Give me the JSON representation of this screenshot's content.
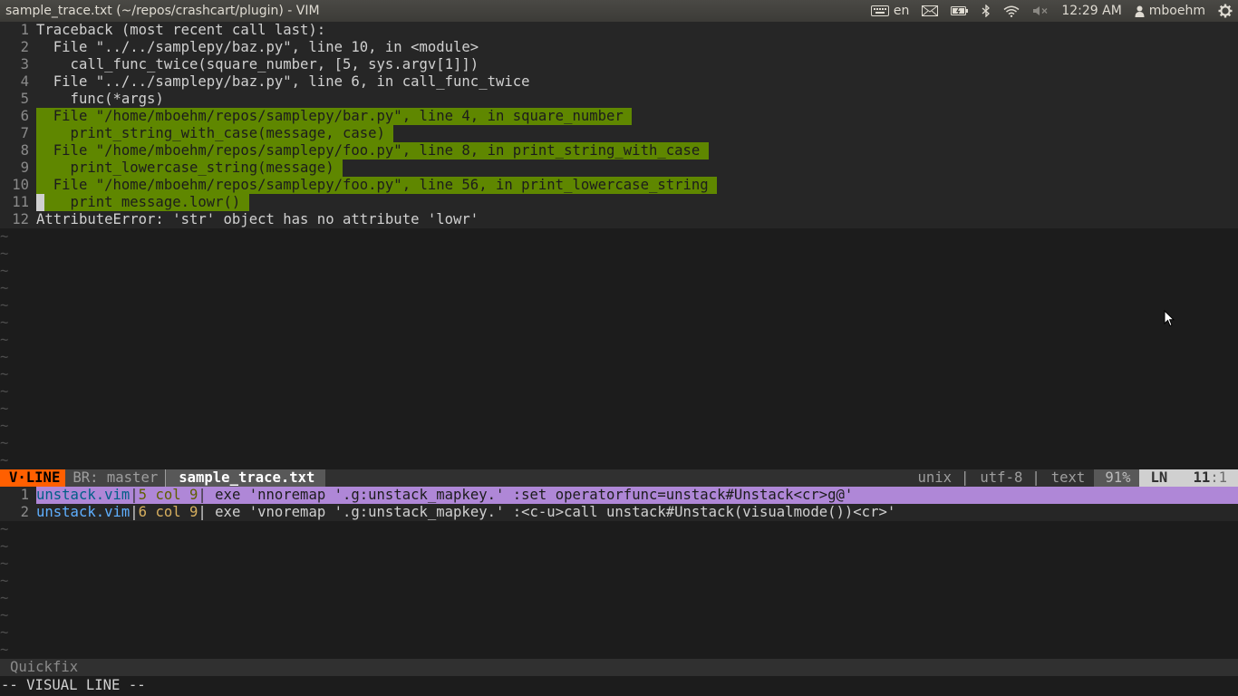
{
  "window": {
    "title": "sample_trace.txt (~/repos/crashcart/plugin) - VIM"
  },
  "tray": {
    "keyboard_label": "en",
    "time": "12:29 AM",
    "user": "mboehm"
  },
  "buffer": {
    "lines": [
      {
        "num": "1",
        "text": "Traceback (most recent call last):",
        "highlight": false
      },
      {
        "num": "2",
        "text": "  File \"../../samplepy/baz.py\", line 10, in <module>",
        "highlight": false
      },
      {
        "num": "3",
        "text": "    call_func_twice(square_number, [5, sys.argv[1]])",
        "highlight": false
      },
      {
        "num": "4",
        "text": "  File \"../../samplepy/baz.py\", line 6, in call_func_twice",
        "highlight": false
      },
      {
        "num": "5",
        "text": "    func(*args)",
        "highlight": false
      },
      {
        "num": "6",
        "text": "  File \"/home/mboehm/repos/samplepy/bar.py\", line 4, in square_number ",
        "highlight": true
      },
      {
        "num": "7",
        "text": "    print_string_with_case(message, case) ",
        "highlight": true
      },
      {
        "num": "8",
        "text": "  File \"/home/mboehm/repos/samplepy/foo.py\", line 8, in print_string_with_case ",
        "highlight": true
      },
      {
        "num": "9",
        "text": "    print_lowercase_string(message) ",
        "highlight": true
      },
      {
        "num": "10",
        "text": "  File \"/home/mboehm/repos/samplepy/foo.py\", line 56, in print_lowercase_string ",
        "highlight": true
      },
      {
        "num": "11",
        "text": "    print message.lowr() ",
        "highlight": true
      },
      {
        "num": "12",
        "text": "AttributeError: 'str' object has no attribute 'lowr'",
        "highlight": false
      }
    ],
    "tilde": "~"
  },
  "statusline": {
    "mode": "V·LINE",
    "branch": "BR: master",
    "file": "sample_trace.txt",
    "fileformat": "unix",
    "encoding": "utf-8",
    "filetype": "text",
    "percent": "91%",
    "ln_label": "LN",
    "line": "11",
    "col": ":1"
  },
  "quickfix": {
    "entries": [
      {
        "num": "1",
        "file": "unstack.vim",
        "pos": "5 col 9",
        "text": " exe 'nnoremap '.g:unstack_mapkey.' :set operatorfunc=unstack#Unstack<cr>g@'",
        "selected": true
      },
      {
        "num": "2",
        "file": "unstack.vim",
        "pos": "6 col 9",
        "text": " exe 'vnoremap '.g:unstack_mapkey.' :<c-u>call unstack#Unstack(visualmode())<cr>'",
        "selected": false
      }
    ],
    "status": "Quickfix"
  },
  "cmdline": "-- VISUAL LINE --",
  "colors": {
    "highlight": "#5f8700",
    "mode": "#ff5f00",
    "qf_selected": "#af87d7"
  }
}
